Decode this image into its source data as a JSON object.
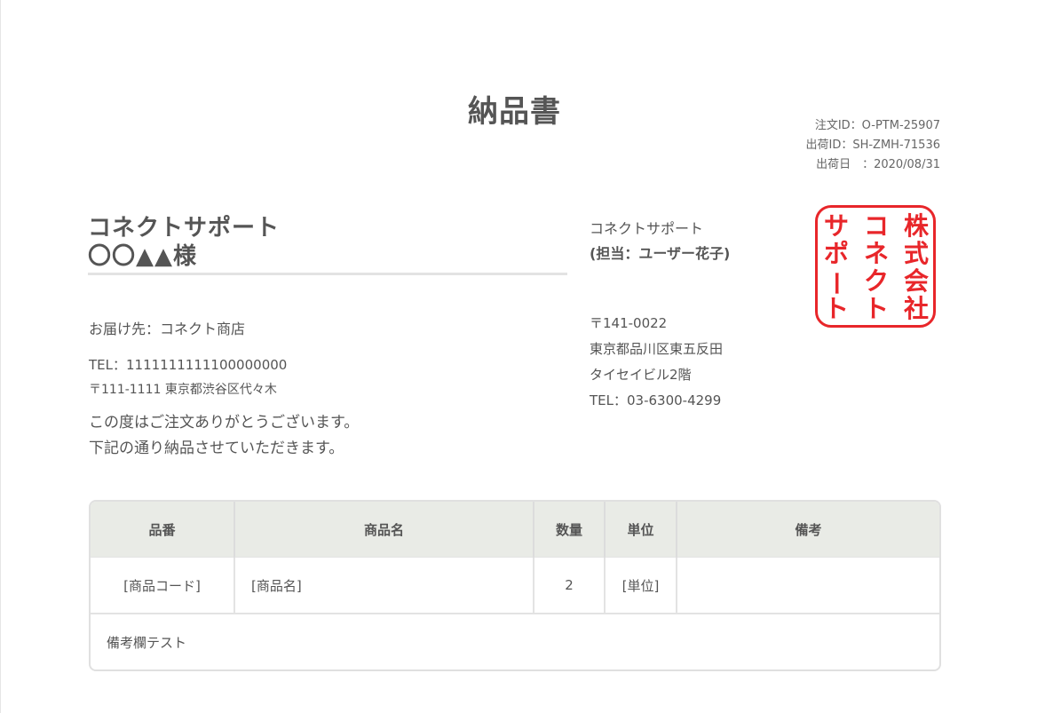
{
  "document": {
    "title": "納品書",
    "meta": {
      "order_id": "注文ID：O-PTM-25907",
      "shipment_id": "出荷ID：SH-ZMH-71536",
      "ship_date": "出荷日　：2020/08/31"
    }
  },
  "recipient": {
    "company": "コネクトサポート",
    "person": "〇〇▲▲様",
    "deliver_to": "お届け先：コネクト商店",
    "tel": "TEL：1111111111100000000",
    "address": "〒111-1111 東京都渋谷区代々木",
    "greeting_1": "この度はご注文ありがとうございます。",
    "greeting_2": "下記の通り納品させていただきます。"
  },
  "sender": {
    "company": "コネクトサポート",
    "contact": "(担当：ユーザー花子)",
    "postal": "〒141-0022",
    "address_1": "東京都品川区東五反田",
    "address_2": "タイセイビル2階",
    "tel": "TEL：03-6300-4299"
  },
  "seal": {
    "text": "株式会社コネクトサポート",
    "color": "#e8262a"
  },
  "table": {
    "headers": [
      "品番",
      "商品名",
      "数量",
      "単位",
      "備考"
    ],
    "rows": [
      [
        "[商品コード]",
        "[商品名]",
        "2",
        "[単位]",
        ""
      ]
    ],
    "remarks": "備考欄テスト"
  }
}
